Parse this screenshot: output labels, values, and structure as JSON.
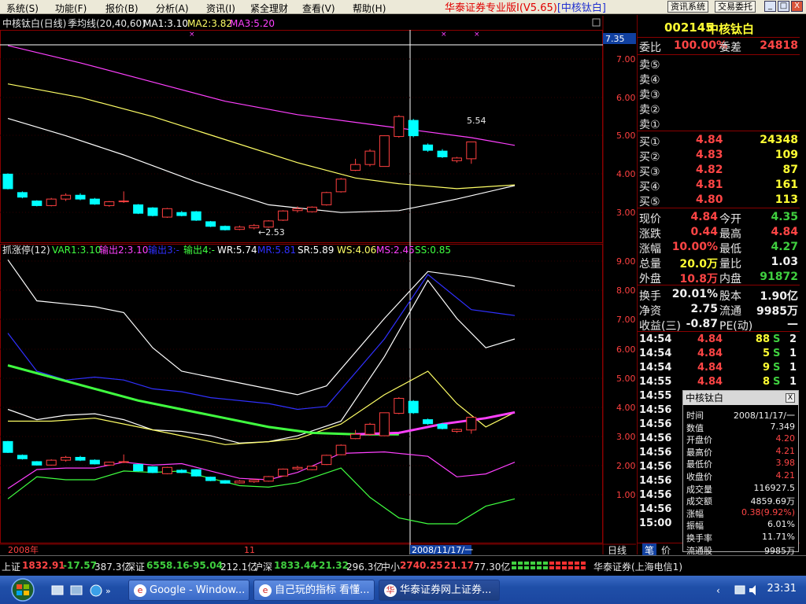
{
  "menu": {
    "items": [
      "系统(S)",
      "功能(F)",
      "报价(B)",
      "分析(A)",
      "资讯(I)",
      "紧全理财",
      "查看(V)",
      "帮助(H)"
    ],
    "app_title": "华泰证券专业版I(V5.65)",
    "title_stock": "[中核钛白]",
    "btn_info": "资讯系统",
    "btn_trade": "交易委托",
    "win_min": "_",
    "win_max": "□",
    "win_close": "X"
  },
  "chart": {
    "header": {
      "name": "中核钛白(日线)",
      "indicator": "季均线(20,40,60)",
      "ma1": "MA1:3.10",
      "ma2": "MA2:3.82",
      "ma3": "MA3:5.20"
    },
    "price_axis": [
      "7.00",
      "6.00",
      "5.00",
      "4.00",
      "3.00"
    ],
    "price_axis_y": [
      75,
      124,
      172,
      221,
      270
    ],
    "current_price_tag": "7.35",
    "high_label": "5.54",
    "low_label": "←2.53",
    "sub_header": {
      "name": "抓涨停(12)",
      "var1": "VAR1:3.10",
      "out2": "输出2:3.10",
      "out3": "输出3:-",
      "out4": "输出4:-",
      "wr": "WR:5.74",
      "mr": "MR:5.81",
      "sr": "SR:5.89",
      "ws": "WS:4.06",
      "ms": "MS:2.45",
      "ss": "SS:0.85"
    },
    "sub_axis": [
      "9.00",
      "8.00",
      "7.00",
      "6.00",
      "5.00",
      "4.00",
      "3.00",
      "2.00",
      "1.00"
    ],
    "sub_axis_y": [
      332,
      369,
      406,
      444,
      481,
      518,
      555,
      592,
      629
    ],
    "x_labels": {
      "year": "2008年",
      "month": "11",
      "cursor_date": "2008/11/17/一"
    },
    "tabs": [
      "日线",
      "笔",
      "价"
    ],
    "colors": {
      "up": "#ff4040",
      "down": "#00ffff",
      "ma1": "#ffffff",
      "ma2": "#ffff66",
      "ma3": "#ff40ff",
      "green": "#40ff40",
      "blue": "#3030ff",
      "grid": "#800000"
    }
  },
  "chart_data": {
    "type": "candlestick",
    "title": "中核钛白(日线)",
    "ylim": [
      2.5,
      7.35
    ],
    "candles": [
      {
        "o": 4.0,
        "c": 3.62,
        "h": 4.02,
        "l": 3.6
      },
      {
        "o": 3.52,
        "c": 3.4,
        "h": 3.55,
        "l": 3.37
      },
      {
        "o": 3.3,
        "c": 3.18,
        "h": 3.32,
        "l": 3.16
      },
      {
        "o": 3.18,
        "c": 3.35,
        "h": 3.38,
        "l": 3.16
      },
      {
        "o": 3.35,
        "c": 3.45,
        "h": 3.5,
        "l": 3.3
      },
      {
        "o": 3.45,
        "c": 3.35,
        "h": 3.5,
        "l": 3.32
      },
      {
        "o": 3.35,
        "c": 3.22,
        "h": 3.38,
        "l": 3.2
      },
      {
        "o": 3.18,
        "c": 3.28,
        "h": 3.3,
        "l": 3.15
      },
      {
        "o": 3.28,
        "c": 3.3,
        "h": 3.55,
        "l": 3.25
      },
      {
        "o": 3.2,
        "c": 2.98,
        "h": 3.22,
        "l": 2.96
      },
      {
        "o": 3.12,
        "c": 2.92,
        "h": 3.14,
        "l": 2.9
      },
      {
        "o": 2.88,
        "c": 3.1,
        "h": 3.12,
        "l": 2.86
      },
      {
        "o": 3.0,
        "c": 2.92,
        "h": 3.04,
        "l": 2.9
      },
      {
        "o": 3.02,
        "c": 2.8,
        "h": 3.04,
        "l": 2.78
      },
      {
        "o": 2.76,
        "c": 2.64,
        "h": 2.78,
        "l": 2.62
      },
      {
        "o": 2.64,
        "c": 2.55,
        "h": 2.66,
        "l": 2.53
      },
      {
        "o": 2.56,
        "c": 2.62,
        "h": 2.66,
        "l": 2.54
      },
      {
        "o": 2.6,
        "c": 2.66,
        "h": 2.7,
        "l": 2.56
      },
      {
        "o": 2.62,
        "c": 2.78,
        "h": 2.8,
        "l": 2.6
      },
      {
        "o": 2.8,
        "c": 3.04,
        "h": 3.06,
        "l": 2.78
      },
      {
        "o": 3.05,
        "c": 3.1,
        "h": 3.16,
        "l": 3.0
      },
      {
        "o": 3.02,
        "c": 3.14,
        "h": 3.16,
        "l": 3.0
      },
      {
        "o": 3.2,
        "c": 3.52,
        "h": 3.54,
        "l": 3.18
      },
      {
        "o": 3.54,
        "c": 3.87,
        "h": 3.9,
        "l": 3.52
      },
      {
        "o": 4.1,
        "c": 4.25,
        "h": 4.4,
        "l": 4.08
      },
      {
        "o": 4.25,
        "c": 4.6,
        "h": 4.65,
        "l": 4.2
      },
      {
        "o": 4.2,
        "c": 5.0,
        "h": 5.0,
        "l": 4.2
      },
      {
        "o": 4.98,
        "c": 5.5,
        "h": 5.54,
        "l": 4.95
      },
      {
        "o": 5.4,
        "c": 5.0,
        "h": 5.44,
        "l": 4.96
      },
      {
        "o": 4.76,
        "c": 4.62,
        "h": 4.8,
        "l": 4.58
      },
      {
        "o": 4.6,
        "c": 4.45,
        "h": 4.65,
        "l": 4.42
      },
      {
        "o": 4.35,
        "c": 4.42,
        "h": 4.45,
        "l": 4.3
      },
      {
        "o": 4.4,
        "c": 4.84,
        "h": 4.84,
        "l": 4.27
      }
    ],
    "ma_series": [
      {
        "name": "MA1",
        "color": "#ffffff",
        "values": [
          [
            0,
            5.45
          ],
          [
            4,
            5.0
          ],
          [
            8,
            4.5
          ],
          [
            13,
            3.8
          ],
          [
            18,
            3.2
          ],
          [
            23,
            3.0
          ],
          [
            27,
            3.05
          ],
          [
            31,
            3.35
          ],
          [
            35,
            3.7
          ]
        ]
      },
      {
        "name": "MA2",
        "color": "#ffff66",
        "values": [
          [
            0,
            6.35
          ],
          [
            5,
            6.0
          ],
          [
            10,
            5.5
          ],
          [
            15,
            4.9
          ],
          [
            20,
            4.3
          ],
          [
            24,
            3.9
          ],
          [
            27,
            3.75
          ],
          [
            31,
            3.62
          ],
          [
            35,
            3.72
          ]
        ]
      },
      {
        "name": "MA3",
        "color": "#ff40ff",
        "values": [
          [
            0,
            7.35
          ],
          [
            5,
            6.9
          ],
          [
            10,
            6.4
          ],
          [
            15,
            5.9
          ],
          [
            20,
            5.55
          ],
          [
            25,
            5.3
          ],
          [
            28,
            5.15
          ],
          [
            32,
            4.95
          ],
          [
            35,
            4.75
          ]
        ]
      }
    ],
    "sub_series": [
      {
        "name": "WR",
        "color": "#ffffff",
        "values": [
          [
            0,
            9.0
          ],
          [
            2,
            7.6
          ],
          [
            4,
            7.5
          ],
          [
            6,
            7.4
          ],
          [
            8,
            7.2
          ],
          [
            10,
            6.0
          ],
          [
            12,
            5.2
          ],
          [
            14,
            5.0
          ],
          [
            18,
            4.6
          ],
          [
            20,
            4.4
          ],
          [
            22,
            4.7
          ],
          [
            26,
            7.0
          ],
          [
            29,
            8.6
          ],
          [
            32,
            8.4
          ],
          [
            35,
            8.1
          ]
        ]
      },
      {
        "name": "MR",
        "color": "#3030ff",
        "values": [
          [
            0,
            6.5
          ],
          [
            2,
            5.2
          ],
          [
            4,
            4.9
          ],
          [
            6,
            5.0
          ],
          [
            8,
            4.9
          ],
          [
            10,
            4.6
          ],
          [
            12,
            4.5
          ],
          [
            14,
            4.3
          ],
          [
            18,
            4.1
          ],
          [
            20,
            3.9
          ],
          [
            22,
            4.0
          ],
          [
            26,
            6.3
          ],
          [
            29,
            8.5
          ],
          [
            32,
            7.3
          ],
          [
            35,
            7.1
          ]
        ]
      },
      {
        "name": "SR",
        "color": "#ffffff",
        "values": [
          [
            0,
            3.9
          ],
          [
            2,
            3.55
          ],
          [
            4,
            3.7
          ],
          [
            6,
            3.75
          ],
          [
            8,
            3.55
          ],
          [
            10,
            3.2
          ],
          [
            12,
            3.15
          ],
          [
            14,
            3.0
          ],
          [
            16,
            2.75
          ],
          [
            18,
            2.8
          ],
          [
            20,
            3.0
          ],
          [
            23,
            3.5
          ],
          [
            26,
            5.7
          ],
          [
            29,
            8.3
          ],
          [
            31,
            7.0
          ],
          [
            33,
            6.0
          ],
          [
            35,
            6.3
          ]
        ]
      },
      {
        "name": "WS",
        "color": "#ffff66",
        "values": [
          [
            0,
            3.5
          ],
          [
            3,
            3.5
          ],
          [
            6,
            3.6
          ],
          [
            9,
            3.3
          ],
          [
            12,
            3.0
          ],
          [
            15,
            2.7
          ],
          [
            18,
            2.8
          ],
          [
            20,
            2.9
          ],
          [
            23,
            3.4
          ],
          [
            26,
            4.4
          ],
          [
            29,
            5.2
          ],
          [
            31,
            4.1
          ],
          [
            33,
            3.3
          ],
          [
            35,
            3.8
          ]
        ]
      },
      {
        "name": "VAR1",
        "color": "#40ff40",
        "values": [
          [
            0,
            5.4
          ],
          [
            3,
            5.0
          ],
          [
            6,
            4.6
          ],
          [
            9,
            4.2
          ],
          [
            12,
            3.9
          ],
          [
            15,
            3.6
          ],
          [
            18,
            3.3
          ],
          [
            21,
            3.1
          ],
          [
            24,
            3.05
          ],
          [
            27,
            3.05
          ]
        ]
      },
      {
        "name": "MS",
        "color": "#ff40ff",
        "values": [
          [
            24,
            3.05
          ],
          [
            27,
            3.1
          ],
          [
            30,
            3.4
          ],
          [
            33,
            3.6
          ],
          [
            35,
            3.8
          ]
        ]
      },
      {
        "name": "MS2",
        "color": "#ff40ff",
        "values": [
          [
            0,
            1.2
          ],
          [
            2,
            1.85
          ],
          [
            4,
            1.9
          ],
          [
            6,
            1.9
          ],
          [
            8,
            2.1
          ],
          [
            10,
            2.0
          ],
          [
            12,
            2.05
          ],
          [
            14,
            1.8
          ],
          [
            16,
            1.55
          ],
          [
            18,
            1.5
          ],
          [
            20,
            1.75
          ],
          [
            23,
            2.4
          ],
          [
            26,
            2.45
          ],
          [
            29,
            2.3
          ],
          [
            31,
            1.6
          ],
          [
            33,
            1.7
          ],
          [
            35,
            2.1
          ]
        ]
      },
      {
        "name": "SS",
        "color": "#40ff40",
        "values": [
          [
            0,
            0.85
          ],
          [
            2,
            1.6
          ],
          [
            4,
            1.5
          ],
          [
            6,
            1.5
          ],
          [
            8,
            1.8
          ],
          [
            10,
            1.75
          ],
          [
            12,
            1.8
          ],
          [
            14,
            1.55
          ],
          [
            16,
            1.3
          ],
          [
            18,
            1.25
          ],
          [
            20,
            1.4
          ],
          [
            23,
            1.9
          ],
          [
            25,
            0.9
          ],
          [
            27,
            0.2
          ],
          [
            29,
            0.0
          ],
          [
            31,
            0.0
          ],
          [
            33,
            0.6
          ],
          [
            35,
            0.85
          ]
        ]
      }
    ]
  },
  "quote": {
    "code": "002145",
    "name": "中核钛白",
    "wb_label": "委比",
    "wb_value": "100.00%",
    "wc_label": "委差",
    "wc_value": "24818",
    "sells": [
      "卖⑤",
      "卖④",
      "卖③",
      "卖②",
      "卖①"
    ],
    "buys": [
      {
        "label": "买①",
        "price": "4.84",
        "vol": "24348"
      },
      {
        "label": "买②",
        "price": "4.83",
        "vol": "109"
      },
      {
        "label": "买③",
        "price": "4.82",
        "vol": "87"
      },
      {
        "label": "买④",
        "price": "4.81",
        "vol": "161"
      },
      {
        "label": "买⑤",
        "price": "4.80",
        "vol": "113"
      }
    ],
    "stats": [
      {
        "l1": "现价",
        "v1": "4.84",
        "c1": "red",
        "l2": "今开",
        "v2": "4.35",
        "c2": "grn"
      },
      {
        "l1": "涨跌",
        "v1": "0.44",
        "c1": "red",
        "l2": "最高",
        "v2": "4.84",
        "c2": "red"
      },
      {
        "l1": "涨幅",
        "v1": "10.00%",
        "c1": "red",
        "l2": "最低",
        "v2": "4.27",
        "c2": "grn"
      },
      {
        "l1": "总量",
        "v1": "20.0万",
        "c1": "yel",
        "l2": "量比",
        "v2": "1.03",
        "c2": "wht"
      },
      {
        "l1": "外盘",
        "v1": "10.8万",
        "c1": "red",
        "l2": "内盘",
        "v2": "91872",
        "c2": "grn"
      }
    ],
    "fund": [
      {
        "l1": "换手",
        "v1": "20.01%",
        "l2": "股本",
        "v2": "1.90亿"
      },
      {
        "l1": "净资",
        "v1": "2.75",
        "l2": "流通",
        "v2": "9985万"
      },
      {
        "l1": "收益(三)",
        "v1": "-0.87",
        "l2": "PE(动)",
        "v2": "—"
      }
    ],
    "ticks": [
      {
        "t": "14:54",
        "p": "4.84",
        "v": "88",
        "f": "S",
        "n": "2"
      },
      {
        "t": "14:54",
        "p": "4.84",
        "v": "5",
        "f": "S",
        "n": "1"
      },
      {
        "t": "14:54",
        "p": "4.84",
        "v": "9",
        "f": "S",
        "n": "1"
      },
      {
        "t": "14:55",
        "p": "4.84",
        "v": "8",
        "f": "S",
        "n": "1"
      },
      {
        "t": "14:55"
      },
      {
        "t": "14:56"
      },
      {
        "t": "14:56"
      },
      {
        "t": "14:56"
      },
      {
        "t": "14:56"
      },
      {
        "t": "14:56"
      },
      {
        "t": "14:56"
      },
      {
        "t": "14:56"
      },
      {
        "t": "14:56"
      },
      {
        "t": "15:00"
      }
    ],
    "tab_bottom": [
      "笔",
      "价"
    ]
  },
  "popup": {
    "title": "中核钛白",
    "close": "X",
    "rows": [
      {
        "k": "时间",
        "v": "2008/11/17/一",
        "c": "wht"
      },
      {
        "k": "数值",
        "v": "7.349",
        "c": "wht"
      },
      {
        "k": "开盘价",
        "v": "4.20",
        "c": "red"
      },
      {
        "k": "最高价",
        "v": "4.21",
        "c": "red"
      },
      {
        "k": "最低价",
        "v": "3.98",
        "c": "red"
      },
      {
        "k": "收盘价",
        "v": "4.21",
        "c": "red"
      },
      {
        "k": "成交量",
        "v": "116927.5",
        "c": "wht"
      },
      {
        "k": "成交额",
        "v": "4859.69万",
        "c": "wht"
      },
      {
        "k": "涨幅",
        "v": "0.38(9.92%)",
        "c": "red"
      },
      {
        "k": "振幅",
        "v": "6.01%",
        "c": "wht"
      },
      {
        "k": "换手率",
        "v": "11.71%",
        "c": "wht"
      },
      {
        "k": "流通股",
        "v": "9985万",
        "c": "wht"
      }
    ]
  },
  "status": {
    "sh_label": "上证",
    "sh_val": "1832.91",
    "sh_chg": "-17.57",
    "sh_amt": "387.3亿",
    "sz_label": "深证",
    "sz_val": "6558.16",
    "sz_chg": "-95.04",
    "sz_amt": "212.1亿",
    "hs_label": "沪深",
    "hs_val": "1833.44",
    "hs_chg": "-21.32",
    "hs_amt": "296.3亿",
    "zx_label": "中小",
    "zx_val": "2740.25",
    "zx_chg": "21.17",
    "zx_amt": "77.30亿",
    "broker": "华泰证券(上海电信1)"
  },
  "taskbar": {
    "tasks": [
      "Google - Window...",
      "自己玩的指标 看懂...",
      "华泰证券网上证券..."
    ],
    "clock": "23:31"
  }
}
